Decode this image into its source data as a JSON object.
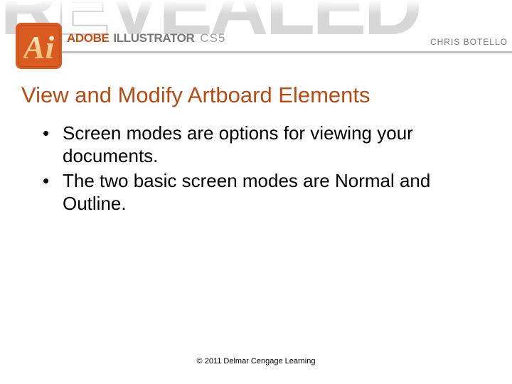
{
  "banner": {
    "background_word": "REVEALED",
    "author": "CHRIS BOTELLO",
    "icon_letters": "Ai",
    "brand": "ADOBE",
    "product": "ILLUSTRATOR",
    "version": "CS5"
  },
  "title": "View and Modify Artboard Elements",
  "bullets": [
    "Screen modes are options for viewing your documents.",
    "The two basic screen modes are Normal and Outline."
  ],
  "footer": "© 2011 Delmar Cengage Learning",
  "colors": {
    "title": "#b84a13",
    "icon_bg": "#d95b1f",
    "brand_text": "#c44f16"
  }
}
